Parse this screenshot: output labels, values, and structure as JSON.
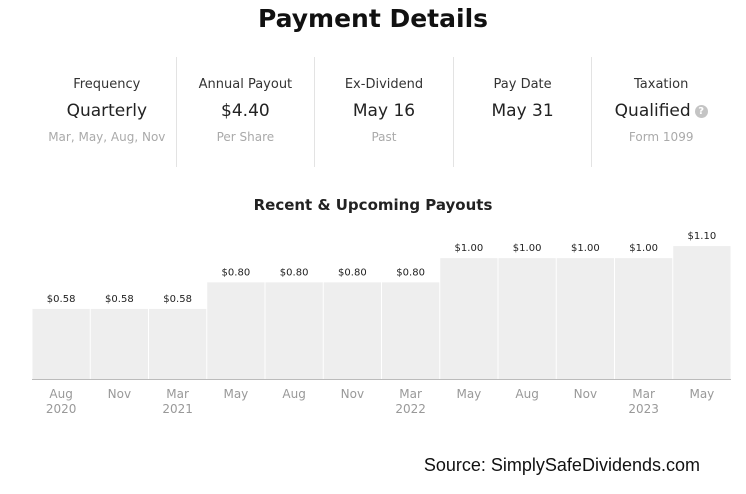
{
  "page": {
    "title": "Payment Details",
    "source": "Source: SimplySafeDividends.com"
  },
  "stats": [
    {
      "label": "Frequency",
      "value": "Quarterly",
      "sub": "Mar, May, Aug, Nov"
    },
    {
      "label": "Annual Payout",
      "value": "$4.40",
      "sub": "Per Share"
    },
    {
      "label": "Ex-Dividend",
      "value": "May 16",
      "sub": "Past"
    },
    {
      "label": "Pay Date",
      "value": "May 31",
      "sub": ""
    },
    {
      "label": "Taxation",
      "value": "Qualified",
      "sub": "Form 1099",
      "icon": "help-icon"
    }
  ],
  "colors": {
    "bar": "#eeeeee",
    "axis": "#bbbbbb",
    "tick_label": "#999999",
    "data_label": "#222222"
  },
  "chart_data": {
    "type": "bar",
    "title": "Recent & Upcoming Payouts",
    "xlabel": "",
    "ylabel": "",
    "categories": [
      [
        "Aug",
        "2020"
      ],
      [
        "Nov",
        ""
      ],
      [
        "Mar",
        "2021"
      ],
      [
        "May",
        ""
      ],
      [
        "Aug",
        ""
      ],
      [
        "Nov",
        ""
      ],
      [
        "Mar",
        "2022"
      ],
      [
        "May",
        ""
      ],
      [
        "Aug",
        ""
      ],
      [
        "Nov",
        ""
      ],
      [
        "Mar",
        "2023"
      ],
      [
        "May",
        ""
      ]
    ],
    "values": [
      0.58,
      0.58,
      0.58,
      0.8,
      0.8,
      0.8,
      0.8,
      1.0,
      1.0,
      1.0,
      1.0,
      1.1
    ],
    "data_labels": [
      "$0.58",
      "$0.58",
      "$0.58",
      "$0.80",
      "$0.80",
      "$0.80",
      "$0.80",
      "$1.00",
      "$1.00",
      "$1.00",
      "$1.00",
      "$1.10"
    ],
    "ylim": [
      0,
      1.2
    ],
    "grid": false,
    "legend": "none"
  }
}
